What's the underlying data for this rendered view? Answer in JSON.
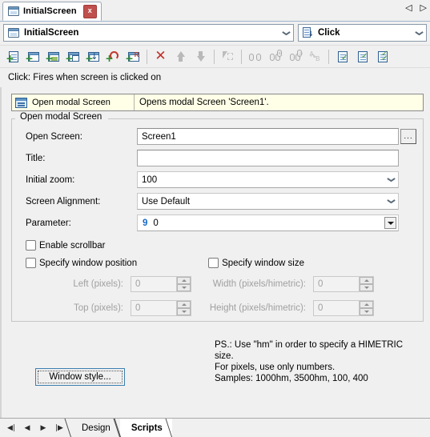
{
  "window": {
    "document_tab": {
      "title": "InitialScreen",
      "icon": "window-icon",
      "close_label": "x"
    },
    "tabstrip_nav": {
      "prev": "◁",
      "next": "▷"
    }
  },
  "selector_bar": {
    "object": {
      "icon": "window-icon",
      "value": "InitialScreen"
    },
    "event": {
      "icon": "event-document-icon",
      "value": "Click"
    }
  },
  "toolbar": {
    "buttons": [
      {
        "name": "new-event-icon",
        "enabled": true
      },
      {
        "name": "new-screen-icon",
        "enabled": true
      },
      {
        "name": "new-image-icon",
        "enabled": true
      },
      {
        "name": "new-window-icon",
        "enabled": true
      },
      {
        "name": "insert-download-icon",
        "enabled": true
      },
      {
        "name": "insert-refresh-icon",
        "enabled": true
      },
      {
        "name": "insert-report-icon",
        "enabled": true
      },
      {
        "name": "delete-icon",
        "enabled": true
      },
      {
        "name": "move-up-icon",
        "enabled": false
      },
      {
        "name": "move-down-icon",
        "enabled": false
      },
      {
        "name": "pointer-select-icon",
        "enabled": false
      },
      {
        "name": "find-icon",
        "enabled": false
      },
      {
        "name": "find-previous-icon",
        "enabled": false
      },
      {
        "name": "find-next-icon",
        "enabled": false
      },
      {
        "name": "replace-icon",
        "enabled": false
      },
      {
        "name": "check-document-icon",
        "enabled": true
      },
      {
        "name": "validate-document-icon",
        "enabled": true
      },
      {
        "name": "validate-all-icon",
        "enabled": true
      }
    ]
  },
  "description": {
    "text": "Click: Fires when screen is clicked on"
  },
  "action_row": {
    "icon": "modal-screen-icon",
    "action": "Open modal Screen",
    "detail": "Opens modal Screen 'Screen1'."
  },
  "group": {
    "legend": "Open modal Screen",
    "fields": {
      "open_screen": {
        "label": "Open Screen:",
        "value": "Screen1",
        "browse_label": "..."
      },
      "title": {
        "label": "Title:",
        "value": "",
        "placeholder": ""
      },
      "initial_zoom": {
        "label": "Initial zoom:",
        "value": "100"
      },
      "screen_alignment": {
        "label": "Screen Alignment:",
        "value": "Use Default"
      },
      "parameter": {
        "label": "Parameter:",
        "token": "9",
        "value": "0"
      }
    },
    "checkboxes": {
      "enable_scrollbar": {
        "label": "Enable scrollbar",
        "checked": false
      },
      "specify_window_position": {
        "label": "Specify window position",
        "checked": false
      },
      "specify_window_size": {
        "label": "Specify window size",
        "checked": false
      }
    },
    "spinners": {
      "left": {
        "label": "Left (pixels):",
        "value": "0",
        "enabled": false
      },
      "top": {
        "label": "Top (pixels):",
        "value": "0",
        "enabled": false
      },
      "width": {
        "label": "Width (pixels/himetric):",
        "value": "0",
        "enabled": false
      },
      "height": {
        "label": "Height (pixels/himetric):",
        "value": "0",
        "enabled": false
      }
    },
    "note": "PS.: Use \"hm\" in order to specify a HIMETRIC size.\nFor pixels, use only numbers.\nSamples: 1000hm, 3500hm, 100, 400",
    "window_style_button": "Window style..."
  },
  "bottom_bar": {
    "nav": {
      "first": "◀|",
      "prev": "◀",
      "next": "▶",
      "last": "|▶"
    },
    "tabs": [
      {
        "label": "Design",
        "active": false
      },
      {
        "label": "Scripts",
        "active": true
      }
    ]
  },
  "colors": {
    "accent_blue": "#1569c7",
    "tab_close_red": "#c0504d",
    "action_row_bg": "#ffffe8",
    "panel_bg": "#f0f0f0"
  }
}
